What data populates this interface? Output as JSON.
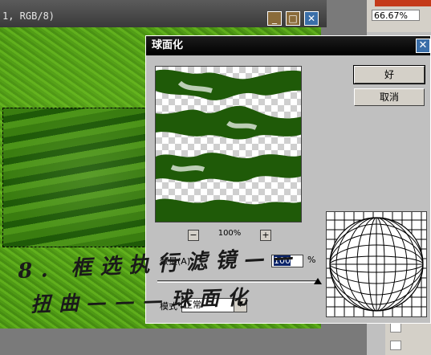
{
  "document": {
    "title": "1, RGB/8)",
    "min_glyph": "_",
    "max_glyph": "□",
    "close_glyph": "✕"
  },
  "navigator": {
    "zoom": "66.67%"
  },
  "dialog": {
    "title": "球面化",
    "close_glyph": "✕",
    "ok_label": "好",
    "cancel_label": "取消",
    "preview_zoom": "100%",
    "zoom_minus": "−",
    "zoom_plus": "+",
    "amount_label": "数量(A):",
    "amount_value": "100",
    "amount_unit": "%",
    "amount_fraction": 1.0,
    "mode_label": "模式",
    "mode_value": "正常",
    "mode_arrow": "▼"
  },
  "annotations": {
    "line1": "8. 框选执行滤镜——",
    "line2": "扭曲———球面化"
  },
  "colors": {
    "titlebar": "#000000",
    "dialog_bg": "#c0c0c0",
    "leaf_green": "#1f5a08",
    "grass_green": "#5fae1c"
  },
  "icons": {
    "close": "close-icon",
    "minimize": "minimize-icon",
    "maximize": "maximize-icon",
    "eye": "eye-icon"
  }
}
